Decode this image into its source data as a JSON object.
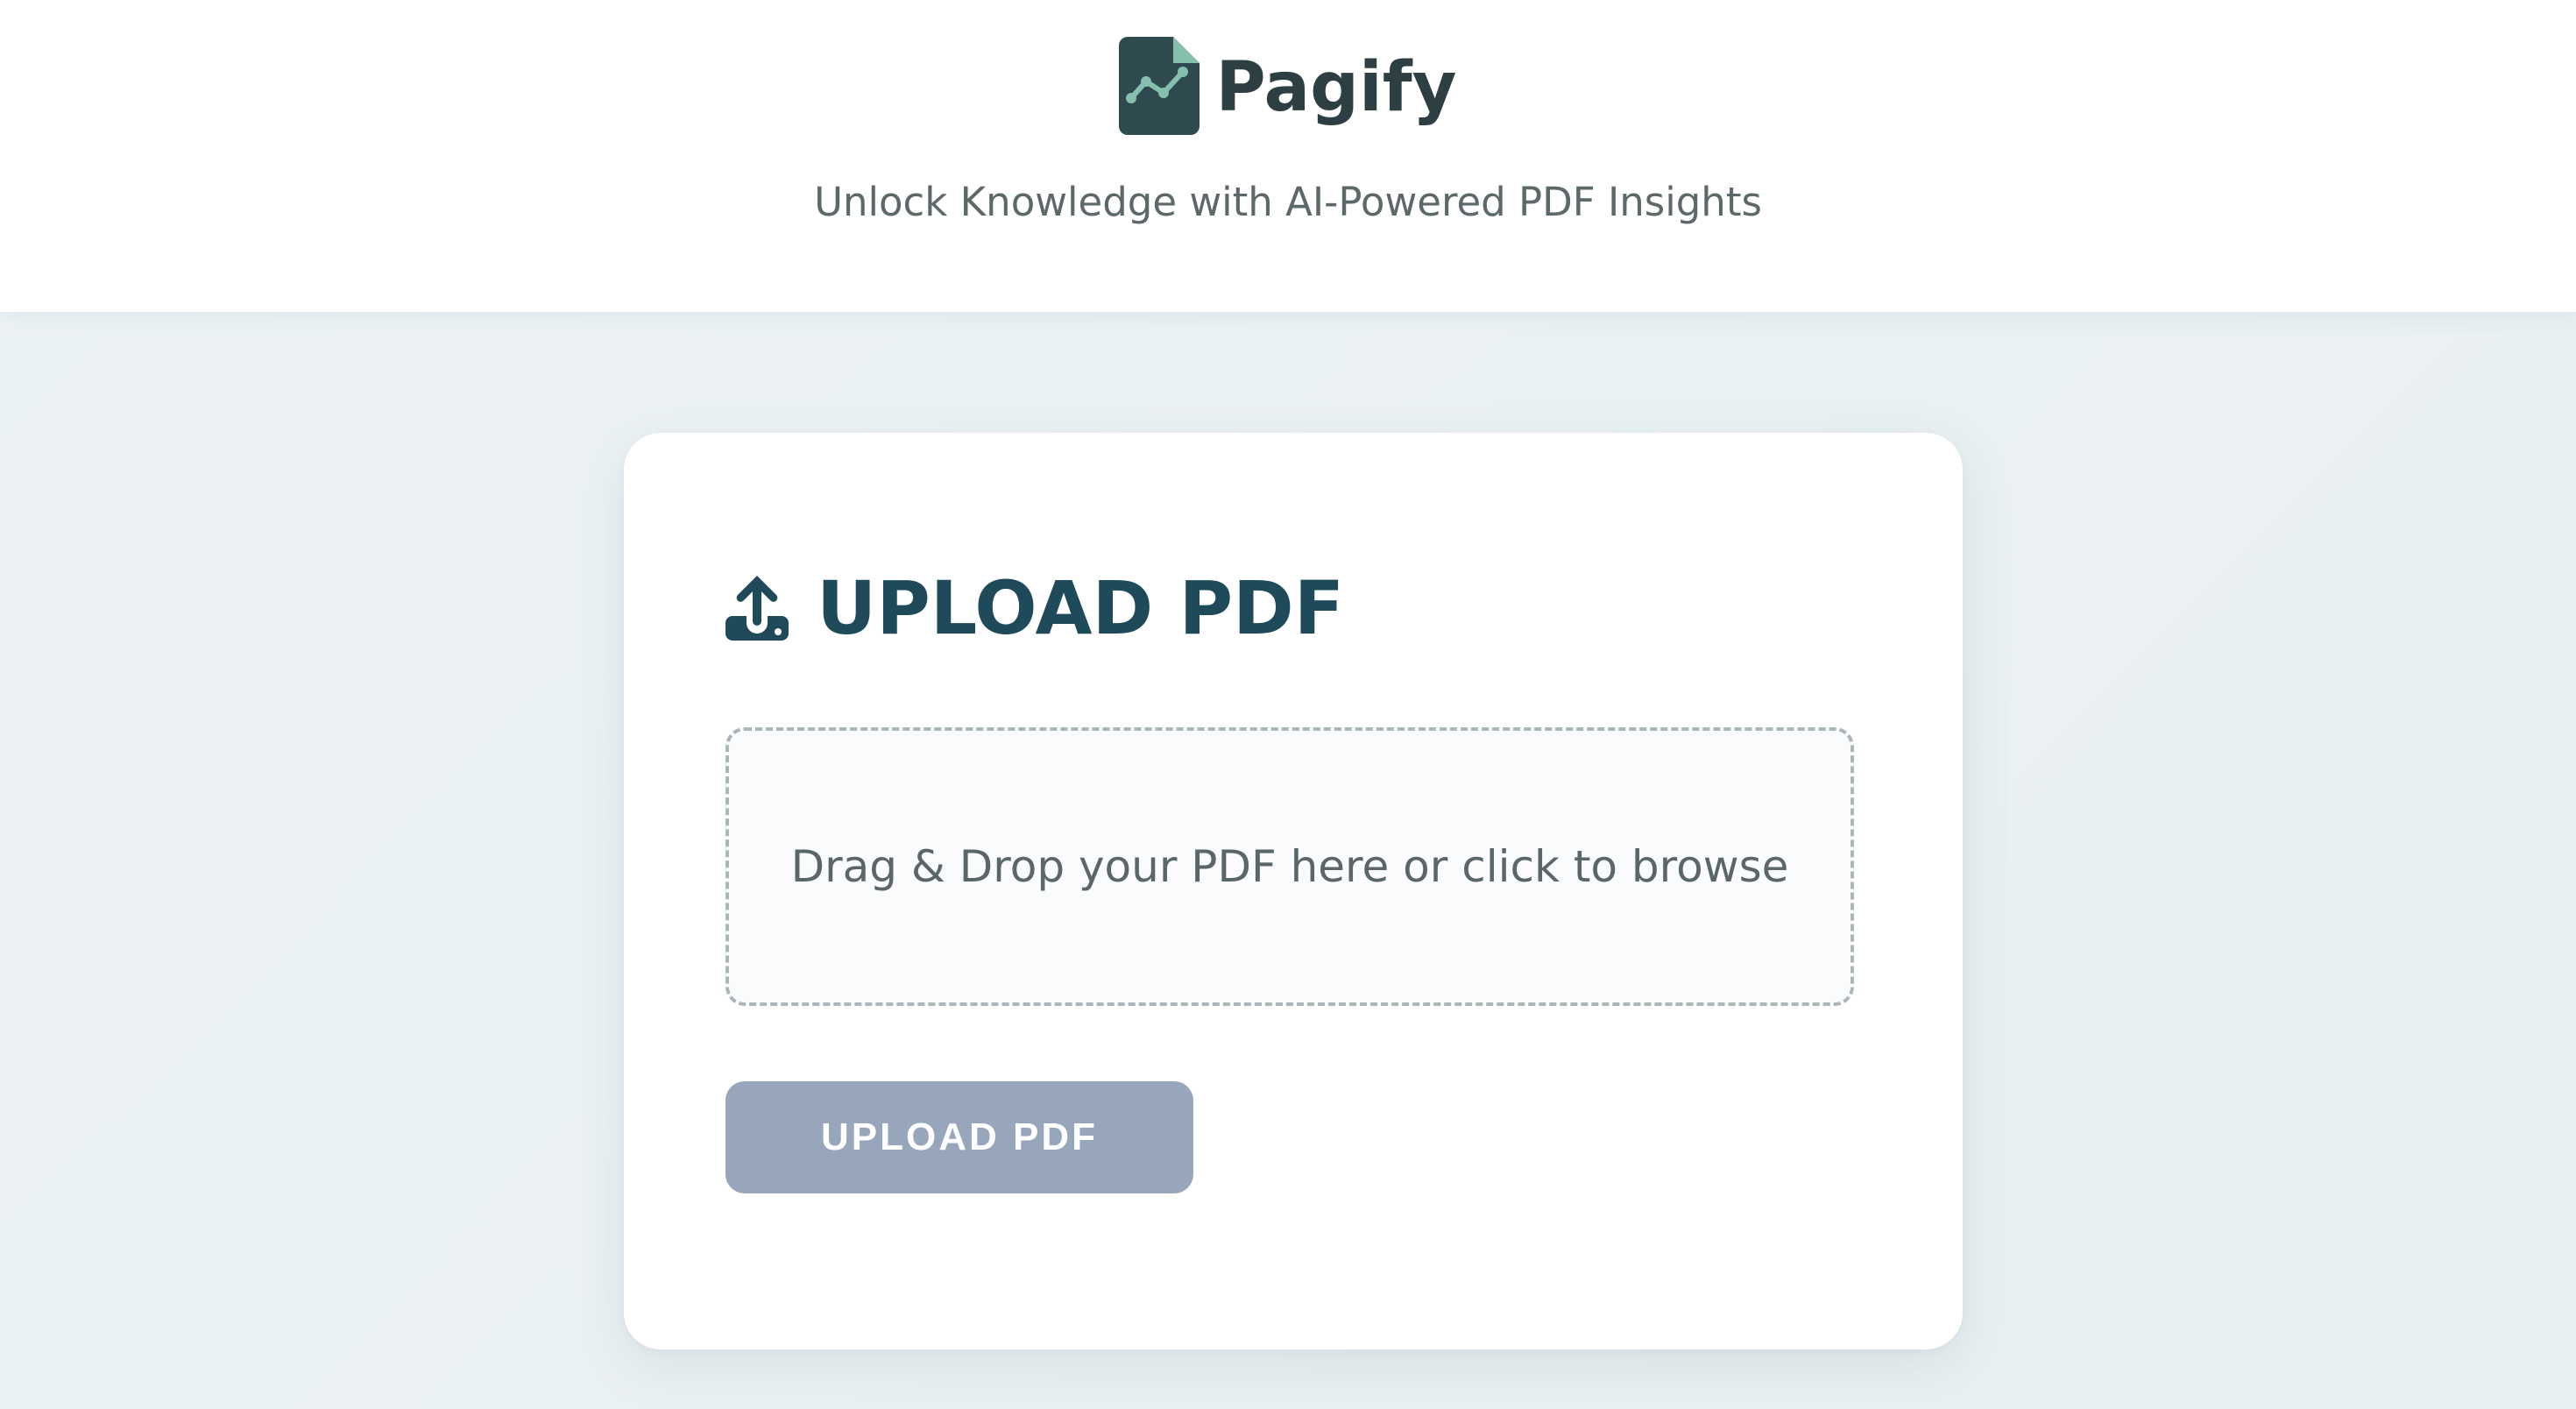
{
  "header": {
    "brand_name": "Pagify",
    "logo_icon": "document-chart-icon",
    "tagline": "Unlock Knowledge with AI-Powered PDF Insights"
  },
  "upload_card": {
    "title_icon": "upload-icon",
    "title": "UPLOAD PDF",
    "dropzone_text": "Drag & Drop your PDF here or click to browse",
    "button_label": "UPLOAD PDF",
    "button_state": "disabled"
  },
  "colors": {
    "page_background": "#edf3f5",
    "header_background": "#ffffff",
    "brand_text": "#2d3f42",
    "logo_body": "#2f4a4f",
    "logo_accent": "#86bfae",
    "title_text": "#1e4a5a",
    "body_text": "#5a6668",
    "dropzone_border": "#aab6b7",
    "button_background": "#97a6ba",
    "button_text": "#ffffff"
  }
}
